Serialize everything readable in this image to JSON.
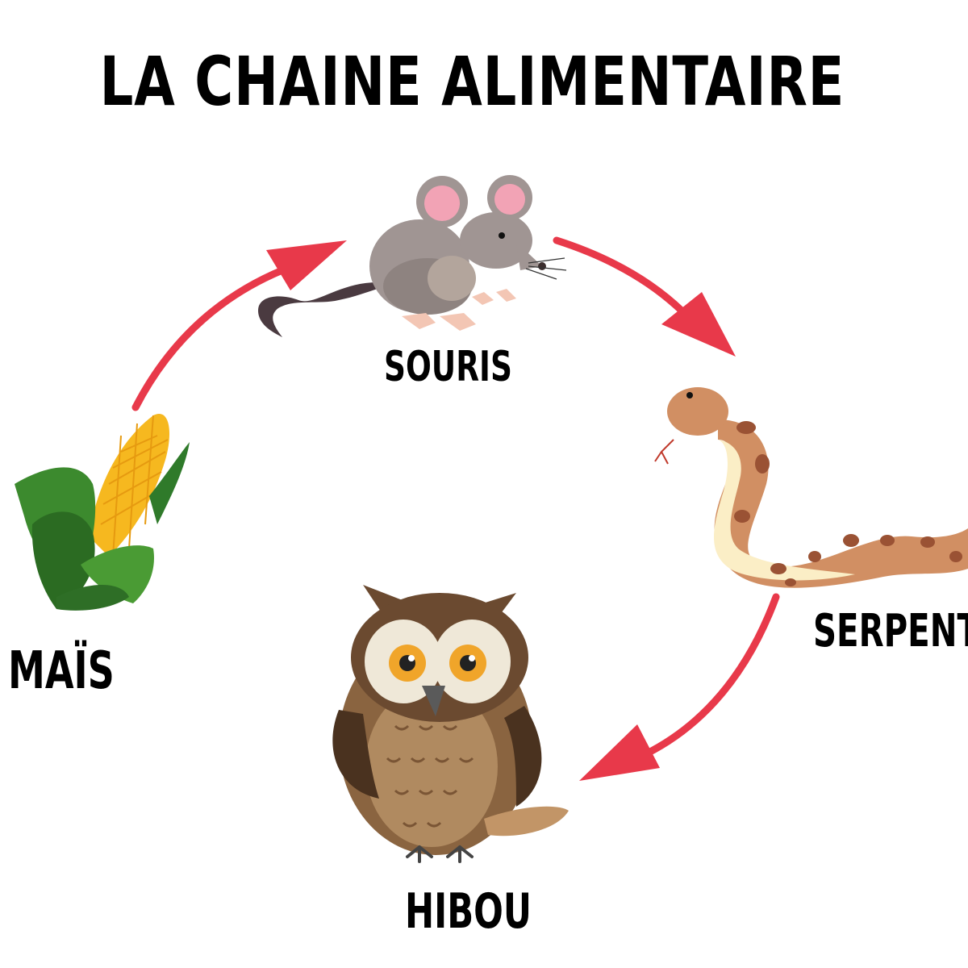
{
  "title": "LA CHAINE ALIMENTAIRE",
  "nodes": {
    "souris": "SOURIS",
    "mais": "MAÏS",
    "serpent": "SERPENT",
    "hibou": "HIBOU"
  },
  "colors": {
    "arrow": "#e8394a",
    "text": "#000000",
    "background": "#ffffff"
  },
  "icons": [
    "mouse-icon",
    "corn-icon",
    "snake-icon",
    "owl-icon"
  ]
}
